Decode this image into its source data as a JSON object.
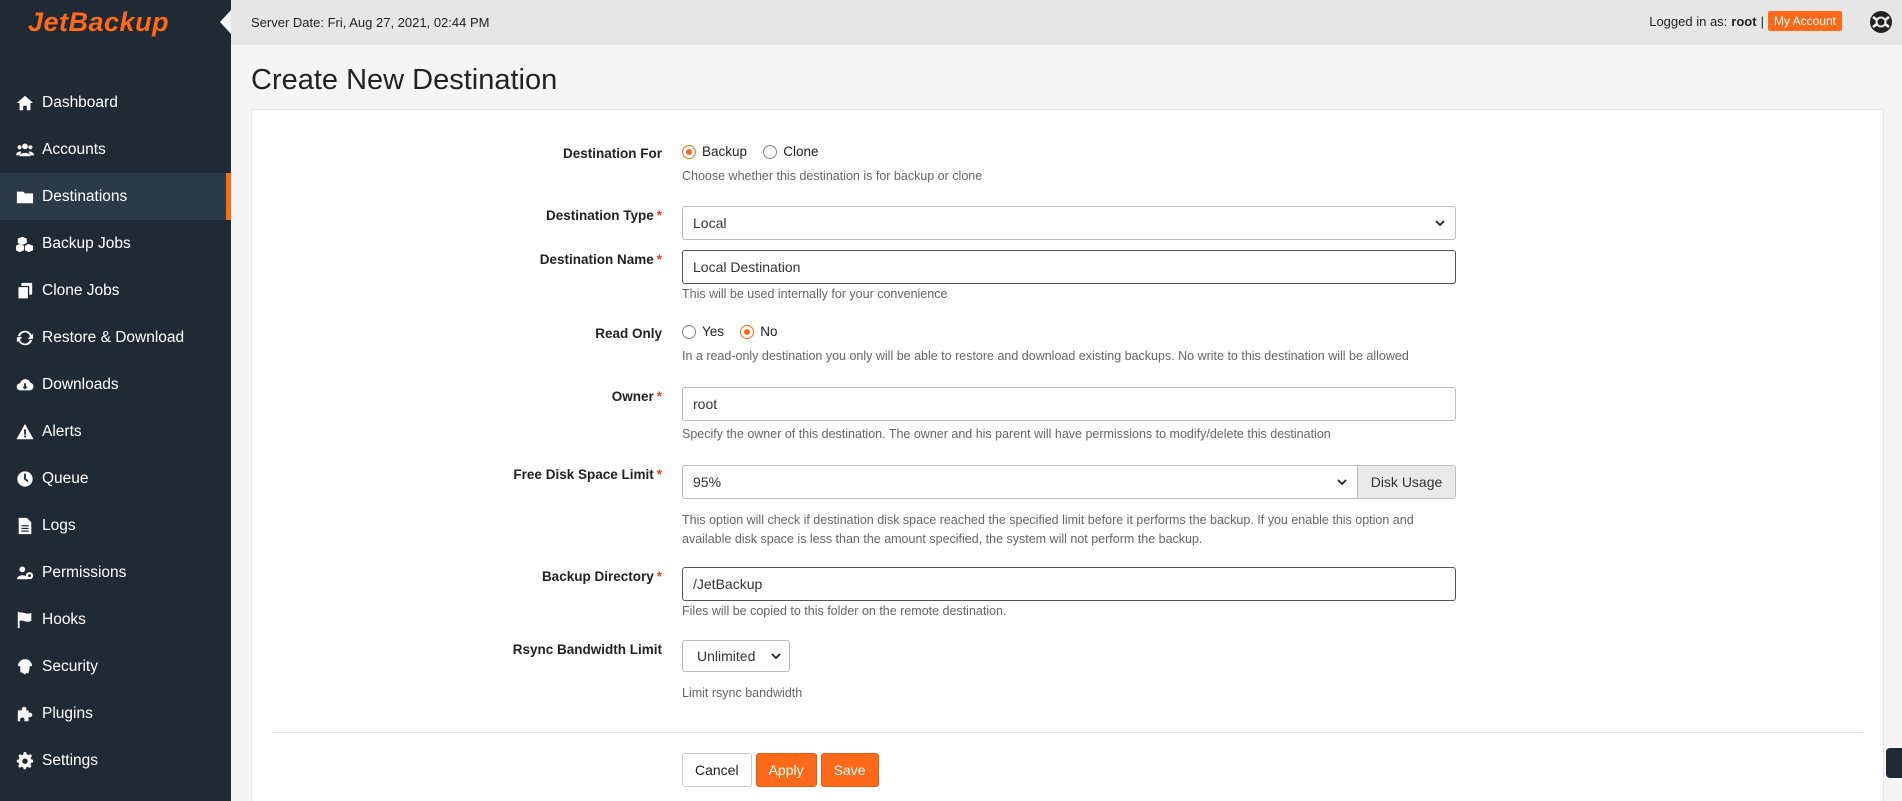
{
  "brand": "JetBackup",
  "topbar": {
    "server_date": "Server Date: Fri, Aug 27, 2021, 02:44 PM",
    "logged_label": "Logged in as:",
    "user": "root",
    "separator": "|",
    "account_button": "My Account"
  },
  "sidebar": {
    "items": [
      {
        "label": "Dashboard",
        "icon": "home-icon"
      },
      {
        "label": "Accounts",
        "icon": "users-icon"
      },
      {
        "label": "Destinations",
        "icon": "folder-icon",
        "active": true
      },
      {
        "label": "Backup Jobs",
        "icon": "cubes-icon"
      },
      {
        "label": "Clone Jobs",
        "icon": "copy-icon"
      },
      {
        "label": "Restore & Download",
        "icon": "sync-icon"
      },
      {
        "label": "Downloads",
        "icon": "cloud-download-icon"
      },
      {
        "label": "Alerts",
        "icon": "warning-icon"
      },
      {
        "label": "Queue",
        "icon": "clock-icon"
      },
      {
        "label": "Logs",
        "icon": "file-icon"
      },
      {
        "label": "Permissions",
        "icon": "users-cog-icon"
      },
      {
        "label": "Hooks",
        "icon": "flag-icon"
      },
      {
        "label": "Security",
        "icon": "fingerprint-icon"
      },
      {
        "label": "Plugins",
        "icon": "puzzle-icon"
      },
      {
        "label": "Settings",
        "icon": "gear-icon"
      }
    ]
  },
  "page": {
    "title": "Create New Destination"
  },
  "form": {
    "destination_for": {
      "label": "Destination For",
      "options": [
        "Backup",
        "Clone"
      ],
      "selected": "Backup",
      "help": "Choose whether this destination is for backup or clone"
    },
    "destination_type": {
      "label": "Destination Type",
      "required": "*",
      "value": "Local"
    },
    "destination_name": {
      "label": "Destination Name",
      "required": "*",
      "value": "Local Destination",
      "help": "This will be used internally for your convenience"
    },
    "read_only": {
      "label": "Read Only",
      "options": [
        "Yes",
        "No"
      ],
      "selected": "No",
      "help": "In a read-only destination you only will be able to restore and download existing backups. No write to this destination will be allowed"
    },
    "owner": {
      "label": "Owner",
      "required": "*",
      "value": "root",
      "help": "Specify the owner of this destination. The owner and his parent will have permissions to modify/delete this destination"
    },
    "free_disk_space": {
      "label": "Free Disk Space Limit",
      "required": "*",
      "value": "95%",
      "addon": "Disk Usage",
      "help1": "This option will check if destination disk space reached the specified limit before it performs the backup. If you enable this option and",
      "help2": "available disk space is less than the amount specified, the system will not perform the backup."
    },
    "backup_directory": {
      "label": "Backup Directory",
      "required": "*",
      "value": "/JetBackup",
      "help": "Files will be copied to this folder on the remote destination."
    },
    "rsync_bandwidth": {
      "label": "Rsync Bandwidth Limit",
      "value": "Unlimited",
      "help": "Limit rsync bandwidth"
    },
    "buttons": {
      "cancel": "Cancel",
      "apply": "Apply",
      "save": "Save"
    }
  },
  "colors": {
    "accent": "#ff6a1a",
    "sidebar_bg": "#1f2a35"
  }
}
